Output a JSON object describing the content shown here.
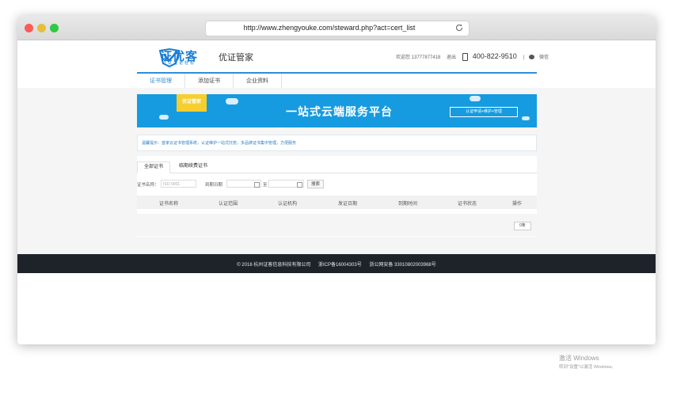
{
  "browser": {
    "url": "http://www.zhengyouke.com/steward.php?act=cert_list"
  },
  "header": {
    "logo_title": "证优客",
    "logo_subtitle": "让认证更轻松",
    "brand": "优证管家",
    "welcome": "欢迎您 13777877418",
    "logout": "退出",
    "phone": "400-822-9510",
    "wechat": "微信"
  },
  "nav": [
    {
      "label": "证书管理"
    },
    {
      "label": "添加证书"
    },
    {
      "label": "企业资料"
    }
  ],
  "banner": {
    "tag": "优证管家",
    "title": "一站式云端服务平台",
    "button": "认证申请+维护+管理"
  },
  "notice": "温馨提示：首家云证书管理系统，认证维护一站式托管，多品牌证书集中管理，方便服务",
  "tabs": [
    {
      "label": "全部证书"
    },
    {
      "label": "临期续费证书"
    }
  ],
  "search": {
    "name_label": "证书名称：",
    "name_placeholder": "ISO 9001",
    "date_label": "到期日期",
    "to_label": "至",
    "button": "搜索"
  },
  "table": {
    "columns": [
      "证书名称",
      "认证范围",
      "认证机构",
      "发证日期",
      "到期时间",
      "证书状态",
      "操作"
    ],
    "count": "0条"
  },
  "footer": {
    "copyright": "© 2016 杭州证客信息科技有限公司",
    "icp": "浙ICP备16004303号",
    "police": "浙公网安备 33010802003968号"
  },
  "watermark": {
    "title": "激活 Windows",
    "subtitle": "转到\"设置\"以激活 Windows。"
  },
  "colors": {
    "accent": "#2e8ed7",
    "banner": "#169be0",
    "tag": "#f6cf2e",
    "footer": "#1e232a"
  }
}
